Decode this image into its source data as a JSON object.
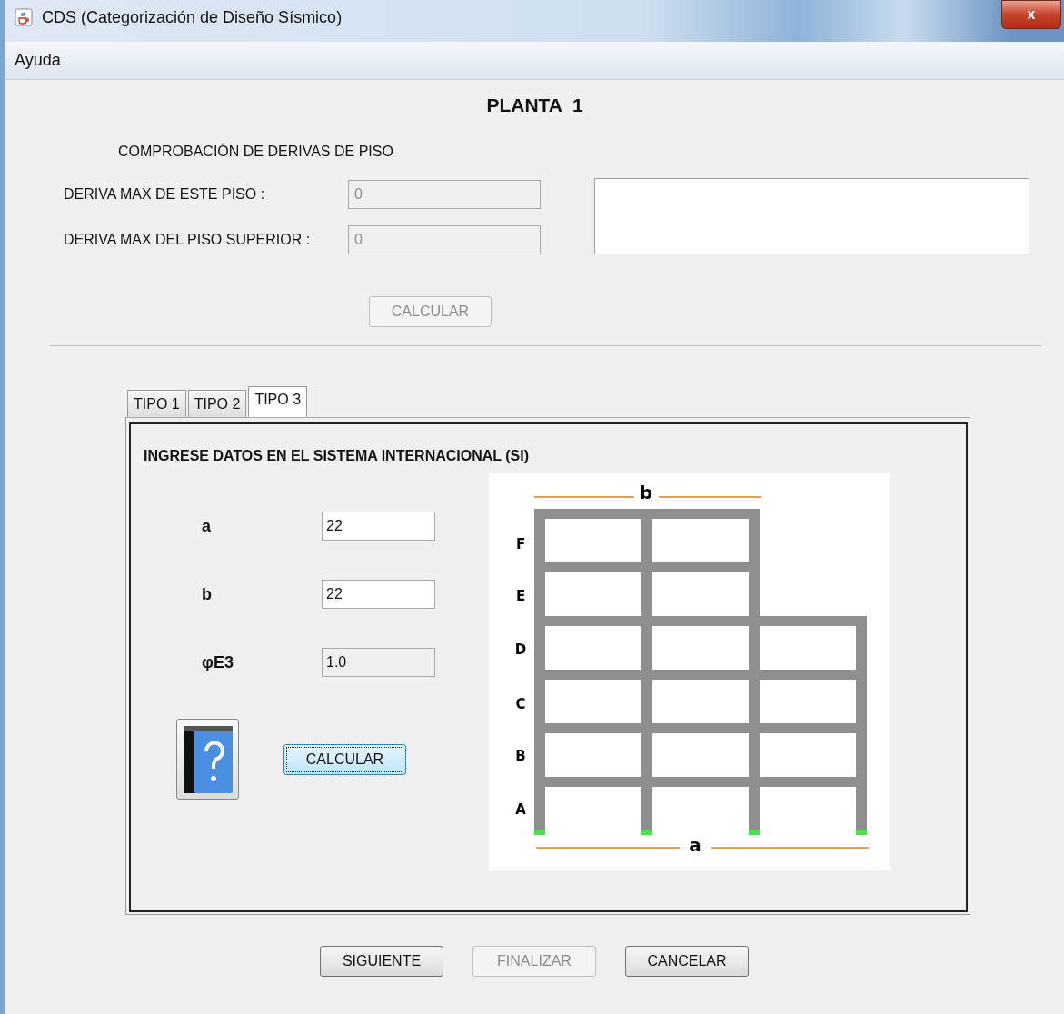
{
  "window": {
    "title": "CDS (Categorización de Diseño Sísmico)",
    "close": "x"
  },
  "menu": [
    {
      "label": "Ayuda"
    }
  ],
  "heading": "PLANTA  1",
  "section_title": "COMPROBACIÓN DE DERIVAS DE PISO",
  "drift_fields": [
    {
      "label": "DERIVA MAX DE ESTE PISO :",
      "value": "0",
      "disabled": true
    },
    {
      "label": "DERIVA MAX DEL PISO SUPERIOR :",
      "value": "0",
      "disabled": true
    }
  ],
  "drift_button": {
    "label": "CALCULAR",
    "disabled": true
  },
  "tabs": [
    {
      "label": "TIPO 1",
      "selected": false
    },
    {
      "label": "TIPO 2",
      "selected": false
    },
    {
      "label": "TIPO 3",
      "selected": true
    }
  ],
  "panel": {
    "title": "INGRESE DATOS EN EL SISTEMA INTERNACIONAL (SI)",
    "fields": [
      {
        "label": "a",
        "value": "22",
        "editable": true
      },
      {
        "label": "b",
        "value": "22",
        "editable": true
      },
      {
        "label": "φE3",
        "value": "1.0",
        "editable": false
      }
    ],
    "button": {
      "label": "CALCULAR",
      "focused": true
    },
    "diagram": {
      "top_label": "b",
      "bottom_label": "a",
      "floors": [
        "F",
        "E",
        "D",
        "C",
        "B",
        "A"
      ]
    }
  },
  "footer_buttons": [
    {
      "label": "SIGUIENTE",
      "disabled": false
    },
    {
      "label": "FINALIZAR",
      "disabled": true
    },
    {
      "label": "CANCELAR",
      "disabled": false
    }
  ]
}
